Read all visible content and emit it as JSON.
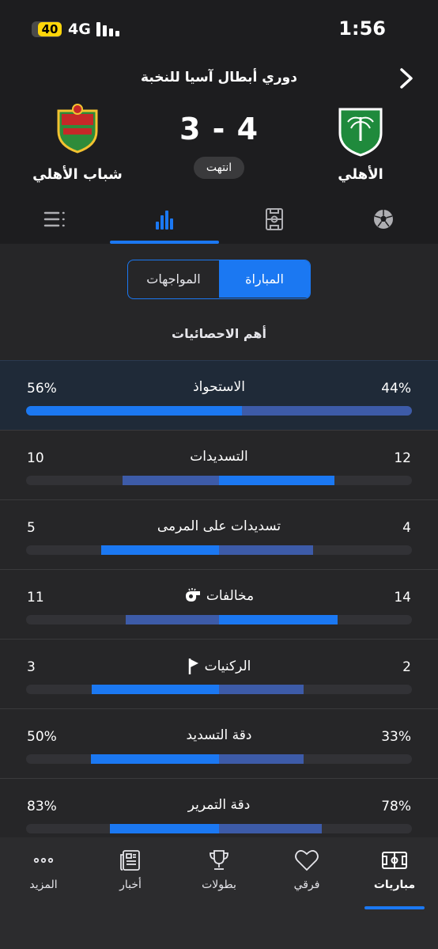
{
  "status_bar": {
    "battery": "40",
    "network": "4G",
    "time": "1:56"
  },
  "header": {
    "league": "دوري أبطال آسيا للنخبة",
    "home_team": "الأهلي",
    "away_team": "شباب الأهلي",
    "score": "3 - 4",
    "match_status": "انتهت"
  },
  "tabs": [
    {
      "icon": "list-icon"
    },
    {
      "icon": "stats-icon",
      "active": true
    },
    {
      "icon": "pitch-icon"
    },
    {
      "icon": "ball-icon"
    }
  ],
  "segmented": {
    "match_label": "المباراة",
    "h2h_label": "المواجهات"
  },
  "section_title": "أهم الاحصائيات",
  "stats": [
    {
      "label": "الاستحواذ",
      "left": "56%",
      "right": "44%",
      "left_val": 56,
      "right_val": 44,
      "highlight": true
    },
    {
      "label": "التسديدات",
      "left": "10",
      "right": "12",
      "left_val": 10,
      "right_val": 12
    },
    {
      "label": "تسديدات على المرمى",
      "left": "5",
      "right": "4",
      "left_val": 5,
      "right_val": 4
    },
    {
      "label": "مخالفات",
      "left": "11",
      "right": "14",
      "left_val": 11,
      "right_val": 14,
      "icon": "whistle-icon"
    },
    {
      "label": "الركنيات",
      "left": "3",
      "right": "2",
      "left_val": 3,
      "right_val": 2,
      "icon": "corner-flag-icon"
    },
    {
      "label": "دقة التسديد",
      "left": "50%",
      "right": "33%",
      "left_val": 50,
      "right_val": 33
    },
    {
      "label": "دقة التمرير",
      "left": "83%",
      "right": "78%",
      "left_val": 83,
      "right_val": 78
    }
  ],
  "bottom_nav": [
    {
      "label": "المزيد",
      "icon": "more-icon"
    },
    {
      "label": "أخبار",
      "icon": "news-icon"
    },
    {
      "label": "بطولات",
      "icon": "trophy-icon"
    },
    {
      "label": "فرقي",
      "icon": "heart-icon"
    },
    {
      "label": "مباريات",
      "icon": "matches-icon",
      "active": true
    }
  ],
  "colors": {
    "accent": "#1b78f2",
    "away_bar": "#3d5ba8",
    "background": "#1d1d1f"
  }
}
